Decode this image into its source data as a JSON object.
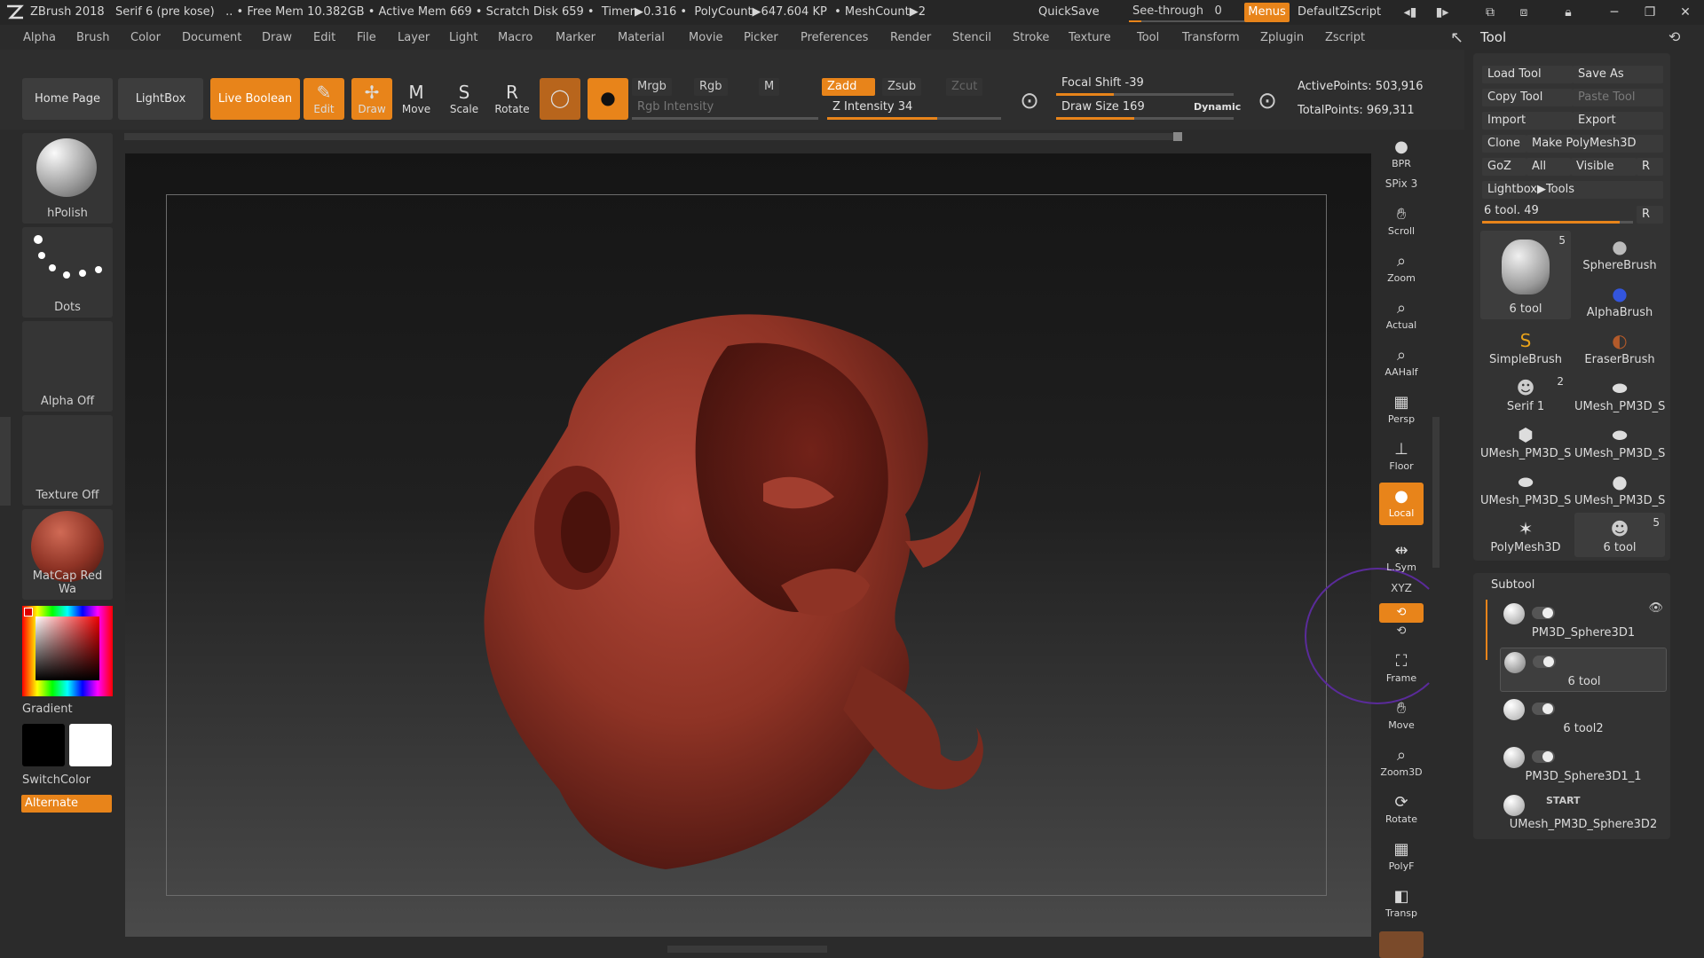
{
  "titlebar": {
    "app": "ZBrush 2018",
    "doc": "Serif 6 (pre kose)",
    "status": ".. • Free Mem 10.382GB • Active Mem 669 • Scratch Disk 659 •",
    "timer": "Timer▶0.316",
    "polycount": "PolyCount▶647.604 KP",
    "meshcount": "• MeshCount▶2",
    "quicksave": "QuickSave",
    "seethrough_label": "See-through",
    "seethrough_value": "0",
    "menus": "Menus",
    "script": "DefaultZScript"
  },
  "menubar": [
    "Alpha",
    "Brush",
    "Color",
    "Document",
    "Draw",
    "Edit",
    "File",
    "Layer",
    "Light",
    "Macro",
    "Marker",
    "Material",
    "Movie",
    "Picker",
    "Preferences",
    "Render",
    "Stencil",
    "Stroke",
    "Texture",
    "Tool",
    "Transform",
    "Zplugin",
    "Zscript"
  ],
  "toolbar": {
    "homepage": "Home Page",
    "lightbox": "LightBox",
    "liveboolean": "Live Boolean",
    "edit": "Edit",
    "draw": "Draw",
    "move": "Move",
    "scale": "Scale",
    "rotate": "Rotate",
    "mrgb": "Mrgb",
    "rgb": "Rgb",
    "m": "M",
    "zadd": "Zadd",
    "zsub": "Zsub",
    "zcut": "Zcut",
    "rgb_intensity": "Rgb Intensity",
    "z_intensity": "Z Intensity 34",
    "focal_shift": "Focal Shift -39",
    "draw_size": "Draw Size 169",
    "dynamic": "Dynamic",
    "active_points": "ActivePoints: 503,916",
    "total_points": "TotalPoints: 969,311"
  },
  "leftshelf": {
    "brush": "hPolish",
    "stroke": "Dots",
    "alpha": "Alpha Off",
    "texture": "Texture Off",
    "material": "MatCap Red Wa",
    "gradient": "Gradient",
    "switchcolor": "SwitchColor",
    "alternate": "Alternate"
  },
  "rightshelf": [
    "BPR",
    "SPix 3",
    "Scroll",
    "Zoom",
    "Actual",
    "AAHalf",
    "Persp",
    "Floor",
    "Local",
    "L.Sym",
    "XYZ",
    "Frame",
    "Move",
    "Zoom3D",
    "Rotate",
    "PolyF",
    "Transp"
  ],
  "toolpanel": {
    "title": "Tool",
    "load_tool": "Load Tool",
    "save_as": "Save As",
    "copy_tool": "Copy Tool",
    "paste_tool": "Paste Tool",
    "import": "Import",
    "export": "Export",
    "clone": "Clone",
    "make_polymesh": "Make PolyMesh3D",
    "goz": "GoZ",
    "all": "All",
    "visible": "Visible",
    "r": "R",
    "lightbox_tools": "Lightbox▶Tools",
    "tool_slider": "6 tool. 49",
    "tools": [
      {
        "name": "6 tool",
        "badge": "5"
      },
      {
        "name": "SphereBrush",
        "badge": ""
      },
      {
        "name": "AlphaBrush",
        "badge": ""
      },
      {
        "name": "SimpleBrush",
        "badge": ""
      },
      {
        "name": "EraserBrush",
        "badge": ""
      },
      {
        "name": "Serif 1",
        "badge": "2"
      },
      {
        "name": "UMesh_PM3D_S",
        "badge": ""
      },
      {
        "name": "UMesh_PM3D_S",
        "badge": ""
      },
      {
        "name": "UMesh_PM3D_S",
        "badge": ""
      },
      {
        "name": "UMesh_PM3D_S",
        "badge": ""
      },
      {
        "name": "UMesh_PM3D_S",
        "badge": ""
      },
      {
        "name": "PolyMesh3D",
        "badge": ""
      },
      {
        "name": "6 tool",
        "badge": "5"
      }
    ],
    "subtool_title": "Subtool",
    "subtools": [
      "PM3D_Sphere3D1",
      "6 tool",
      "6 tool2",
      "PM3D_Sphere3D1_1",
      "UMesh_PM3D_Sphere3D2"
    ],
    "start": "START"
  },
  "colors": {
    "accent": "#e8841a",
    "bg": "#2b2b2b",
    "mesh": "#8e3325"
  }
}
